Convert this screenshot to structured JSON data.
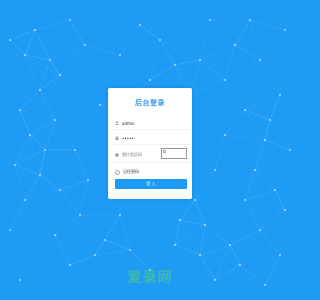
{
  "theme": {
    "background": "#1e9cf5",
    "accent": "#3a95e8",
    "card": "#ffffff"
  },
  "login": {
    "title": "后台登录",
    "username_value": "admin",
    "password_value": "•••••",
    "captcha_placeholder": "图片验证码",
    "remember_label": "记住密码",
    "submit_label": "登 入"
  },
  "icons": {
    "user": "user-icon",
    "lock": "lock-icon",
    "captcha": "shield-icon",
    "remember": "radio-icon"
  },
  "watermark": "爱录网"
}
